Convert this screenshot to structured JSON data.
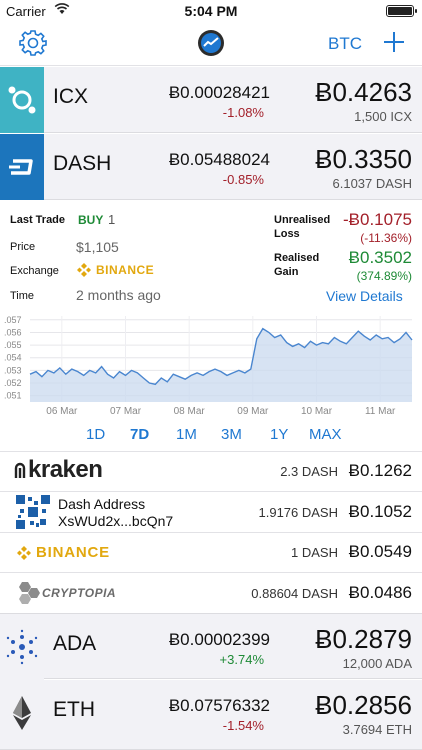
{
  "status_bar": {
    "carrier": "Carrier",
    "time": "5:04 PM"
  },
  "nav": {
    "currency_label": "BTC"
  },
  "coins": [
    {
      "symbol": "ICX",
      "price": "Ƀ0.00028421",
      "change": "-1.08%",
      "value": "Ƀ0.4263",
      "holding": "1,500 ICX"
    },
    {
      "symbol": "DASH",
      "price": "Ƀ0.05488024",
      "change": "-0.85%",
      "value": "Ƀ0.3350",
      "holding": "6.1037 DASH"
    },
    {
      "symbol": "ADA",
      "price": "Ƀ0.00002399",
      "change": "+3.74%",
      "value": "Ƀ0.2879",
      "holding": "12,000 ADA"
    },
    {
      "symbol": "ETH",
      "price": "Ƀ0.07576332",
      "change": "-1.54%",
      "value": "Ƀ0.2856",
      "holding": "3.7694 ETH"
    }
  ],
  "detail": {
    "last_trade_label": "Last Trade",
    "trade_type": "BUY",
    "trade_qty": "1",
    "price_label": "Price",
    "price_value": "$1,105",
    "exchange_label": "Exchange",
    "exchange_value": "BINANCE",
    "time_label": "Time",
    "time_value": "2 months ago",
    "unrealised_label_1": "Unrealised",
    "unrealised_label_2": "Loss",
    "unrealised_value": "-Ƀ0.1075",
    "unrealised_pct": "(-11.36%)",
    "realised_label_1": "Realised",
    "realised_label_2": "Gain",
    "realised_value": "Ƀ0.3502",
    "realised_pct": "(374.89%)",
    "view_details": "View Details"
  },
  "chart_data": {
    "type": "area",
    "x_labels": [
      "06 Mar",
      "07 Mar",
      "08 Mar",
      "09 Mar",
      "10 Mar",
      "11 Mar"
    ],
    "y_ticks": [
      ".051",
      ".052",
      ".053",
      ".054",
      ".055",
      ".056",
      ".057"
    ],
    "ylim": [
      0.0505,
      0.0573
    ],
    "values": [
      0.0527,
      0.0529,
      0.0525,
      0.053,
      0.0528,
      0.0532,
      0.0527,
      0.0531,
      0.0529,
      0.0526,
      0.053,
      0.0528,
      0.0533,
      0.0527,
      0.0524,
      0.0529,
      0.0526,
      0.053,
      0.0528,
      0.0524,
      0.052,
      0.0519,
      0.0524,
      0.0521,
      0.0527,
      0.0525,
      0.0523,
      0.0526,
      0.0528,
      0.0526,
      0.0529,
      0.0531,
      0.0529,
      0.0526,
      0.0528,
      0.053,
      0.0528,
      0.0531,
      0.0555,
      0.0563,
      0.056,
      0.0556,
      0.0558,
      0.0552,
      0.0549,
      0.0551,
      0.0548,
      0.0553,
      0.055,
      0.0552,
      0.0551,
      0.0556,
      0.0553,
      0.0551,
      0.0556,
      0.0561,
      0.0557,
      0.0554,
      0.0558,
      0.0555,
      0.0556,
      0.0552,
      0.0555,
      0.056,
      0.0554
    ],
    "grid": true
  },
  "ranges": [
    "1D",
    "7D",
    "1M",
    "3M",
    "1Y",
    "MAX"
  ],
  "active_range": "7D",
  "exchanges": [
    {
      "name": "kraken",
      "amount": "2.3 DASH",
      "value": "Ƀ0.1262"
    },
    {
      "name_line1": "Dash Address",
      "name_line2": "XsWUd2x...bcQn7",
      "amount": "1.9176 DASH",
      "value": "Ƀ0.1052"
    },
    {
      "name": "BINANCE",
      "amount": "1 DASH",
      "value": "Ƀ0.0549"
    },
    {
      "name": "CRYPTOPIA",
      "amount": "0.88604 DASH",
      "value": "Ƀ0.0486"
    }
  ],
  "colors": {
    "accent": "#1f78d1",
    "negative": "#a3202a",
    "positive": "#1e8a36",
    "binance": "#e2a80f"
  }
}
